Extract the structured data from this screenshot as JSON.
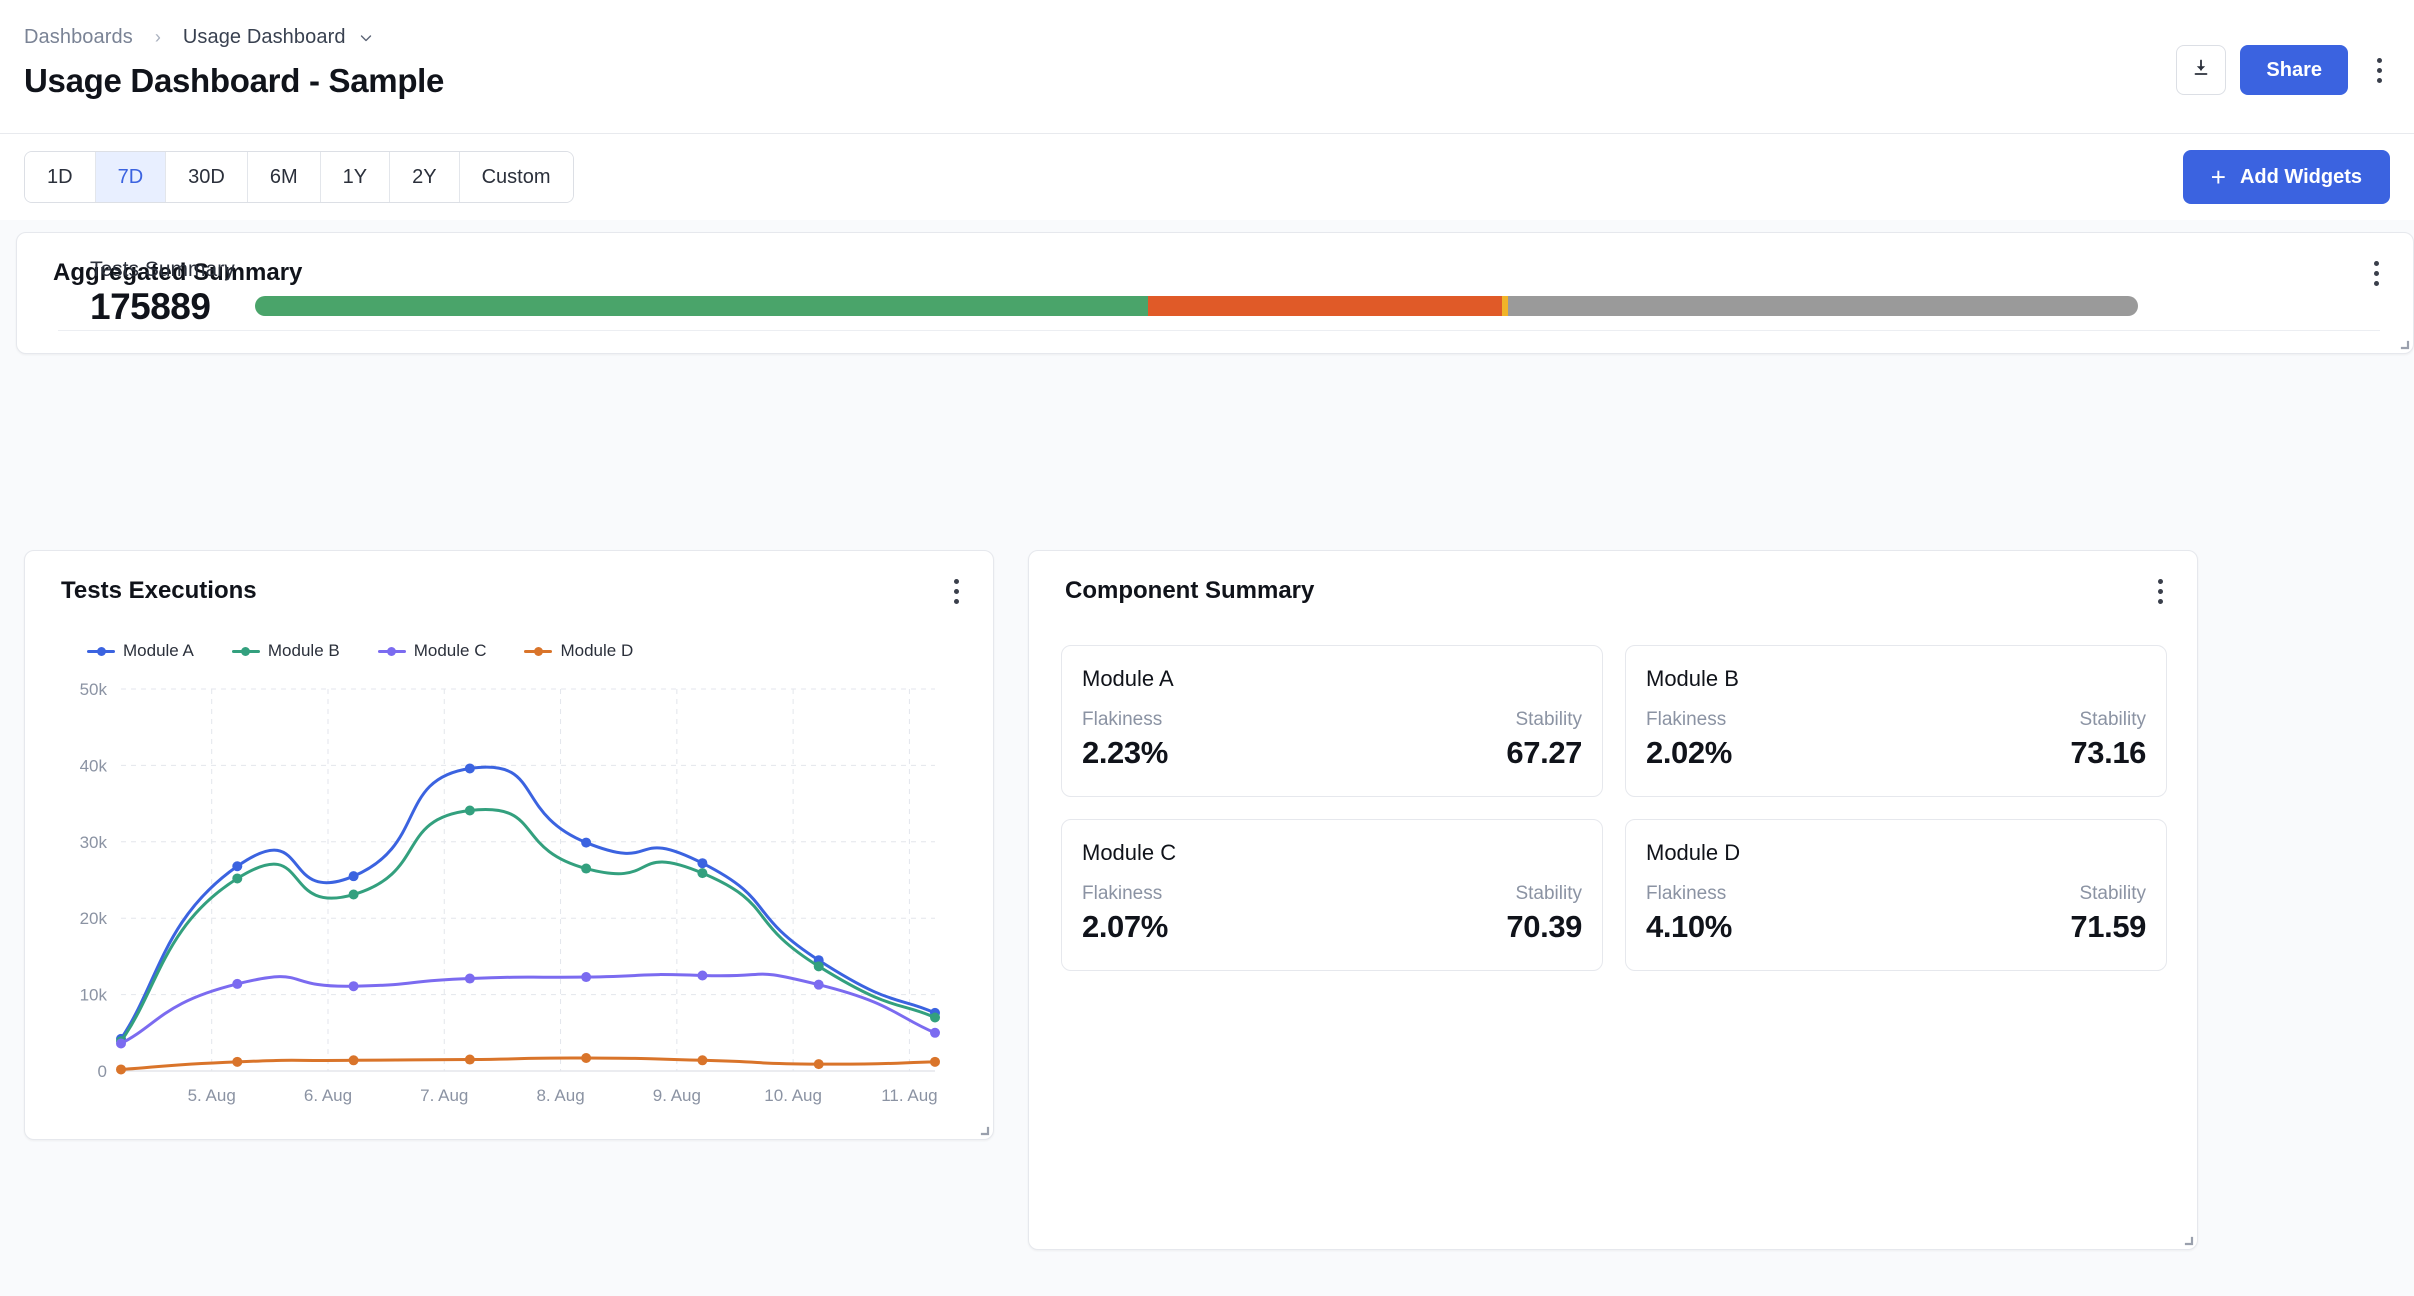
{
  "header": {
    "breadcrumb": {
      "root": "Dashboards",
      "separator": "›",
      "current": "Usage Dashboard"
    },
    "title": "Usage Dashboard - Sample",
    "download_icon": "download-icon",
    "share_label": "Share",
    "more_icon": "more-vertical-icon",
    "accent_color": "#3b63e0"
  },
  "toolbar": {
    "ranges": [
      {
        "label": "1D",
        "active": false
      },
      {
        "label": "7D",
        "active": true
      },
      {
        "label": "30D",
        "active": false
      },
      {
        "label": "6M",
        "active": false
      },
      {
        "label": "1Y",
        "active": false
      },
      {
        "label": "2Y",
        "active": false
      },
      {
        "label": "Custom",
        "active": false
      }
    ],
    "add_widgets_label": "Add Widgets",
    "add_widgets_icon": "plus-icon"
  },
  "aggregated_summary": {
    "title": "Aggregated Summary",
    "menu_icon": "more-vertical-icon",
    "metric_label": "Tests Summary",
    "metric_value": "175889",
    "bar_segments": [
      {
        "name": "passed",
        "color": "#4aa46a",
        "percent": 47.4
      },
      {
        "name": "failed",
        "color": "#e05a28",
        "percent": 18.8
      },
      {
        "name": "pending",
        "color": "#f0b429",
        "percent": 0.35
      },
      {
        "name": "skipped",
        "color": "#9a9a9a",
        "percent": 33.45
      }
    ]
  },
  "tests_executions": {
    "title": "Tests Executions",
    "menu_icon": "more-vertical-icon"
  },
  "chart_data": {
    "type": "line",
    "title": "Tests Executions",
    "xlabel": "",
    "ylabel": "",
    "x": [
      "5. Aug",
      "6. Aug",
      "7. Aug",
      "8. Aug",
      "9. Aug",
      "10. Aug",
      "11. Aug"
    ],
    "x_tick_labels": [
      "5. Aug",
      "6. Aug",
      "7. Aug",
      "8. Aug",
      "9. Aug",
      "10. Aug",
      "11. Aug"
    ],
    "y_tick_labels": [
      "0",
      "10k",
      "20k",
      "30k",
      "40k",
      "50k"
    ],
    "y_ticks": [
      0,
      10000,
      20000,
      30000,
      40000,
      50000
    ],
    "ylim": [
      0,
      50000
    ],
    "grid": true,
    "legend_position": "top-left",
    "series": [
      {
        "name": "Module A",
        "color": "#3b63e0",
        "values": [
          4200,
          26800,
          25500,
          39600,
          29900,
          27200,
          14500,
          7600
        ]
      },
      {
        "name": "Module B",
        "color": "#33a07e",
        "values": [
          3900,
          25200,
          23100,
          34100,
          26500,
          25900,
          13700,
          7000
        ]
      },
      {
        "name": "Module C",
        "color": "#7b6bf0",
        "values": [
          3600,
          11400,
          11100,
          12100,
          12300,
          12500,
          11300,
          5000
        ]
      },
      {
        "name": "Module D",
        "color": "#d9742a",
        "values": [
          200,
          1200,
          1400,
          1500,
          1700,
          1400,
          900,
          1200
        ]
      }
    ]
  },
  "component_summary": {
    "title": "Component Summary",
    "menu_icon": "more-vertical-icon",
    "flakiness_label": "Flakiness",
    "stability_label": "Stability",
    "modules": [
      {
        "name": "Module A",
        "flakiness": "2.23%",
        "stability": "67.27"
      },
      {
        "name": "Module B",
        "flakiness": "2.02%",
        "stability": "73.16"
      },
      {
        "name": "Module C",
        "flakiness": "2.07%",
        "stability": "70.39"
      },
      {
        "name": "Module D",
        "flakiness": "4.10%",
        "stability": "71.59"
      }
    ]
  }
}
